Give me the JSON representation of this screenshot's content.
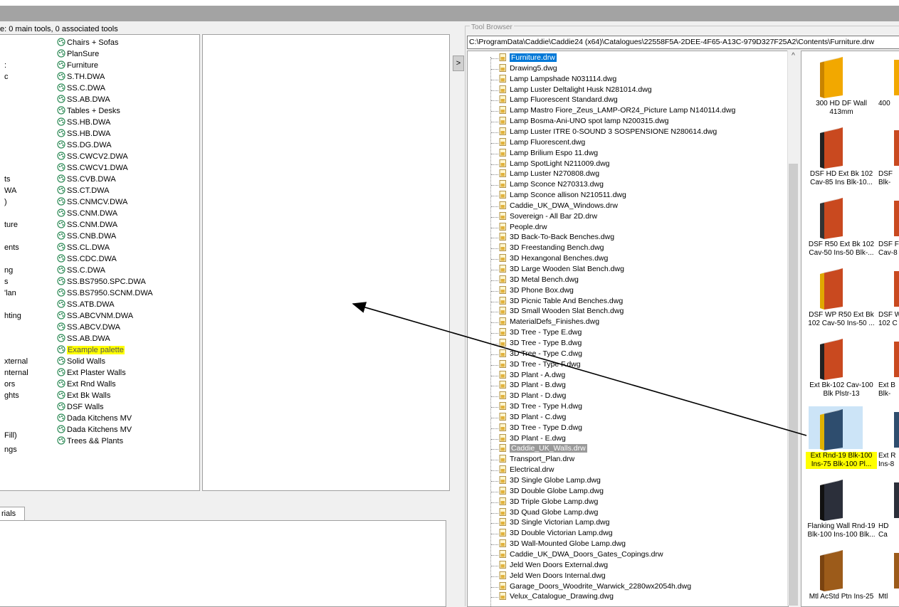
{
  "left": {
    "caption": "e: 0 main tools, 0 associated tools",
    "palettes": [
      "Chairs + Sofas",
      "PlanSure",
      "Furniture",
      "S.TH.DWA",
      "SS.C.DWA",
      "SS.AB.DWA",
      "Tables + Desks",
      "SS.HB.DWA",
      "SS.HB.DWA",
      "SS.DG.DWA",
      "SS.CWCV2.DWA",
      "SS.CWCV1.DWA",
      "SS.CVB.DWA",
      "SS.CT.DWA",
      "SS.CNMCV.DWA",
      "SS.CNM.DWA",
      "SS.CNM.DWA",
      "SS.CNB.DWA",
      "SS.CL.DWA",
      "SS.CDC.DWA",
      "SS.C.DWA",
      "SS.BS7950.SPC.DWA",
      "SS.BS7950.SCNM.DWA",
      "SS.ATB.DWA",
      "SS.ABCVNM.DWA",
      "SS.ABCV.DWA",
      "SS.AB.DWA",
      "Example palette",
      "Solid Walls",
      "Ext Plaster Walls",
      "Ext Rnd Walls",
      "Ext Bk Walls",
      "DSF Walls",
      "Dada Kitchens MV",
      "Dada Kitchens MV",
      "Trees && Plants"
    ],
    "fragments": [
      ":",
      "c",
      ":",
      "ts",
      "WA",
      ")",
      "ture",
      "ents",
      "ng",
      "s",
      "'lan",
      "hting",
      "xternal",
      "nternal",
      "ors",
      "ghts",
      "Fill)",
      "ngs"
    ],
    "tab_label": "rials"
  },
  "browser": {
    "collapse_label": ">",
    "title": "Tool Browser",
    "path": "C:\\ProgramData\\Caddie\\Caddie24 (x64)\\Catalogues\\22558F5A-2DEE-4F65-A13C-979D327F25A2\\Contents\\Furniture.drw",
    "scroll_up": "^",
    "files": [
      "Furniture.drw",
      "Drawing5.dwg",
      "Lamp Lampshade N031114.dwg",
      "Lamp Luster Deltalight Husk N281014.dwg",
      "Lamp Fluorescent Standard.dwg",
      "Lamp Mastro Fiore_Zeus_LAMP-OR24_Picture Lamp N140114.dwg",
      "Lamp Bosma-Ani-UNO spot lamp N200315.dwg",
      "Lamp Luster ITRE 0-SOUND 3 SOSPENSIONE N280614.dwg",
      "Lamp Fluorescent.dwg",
      "Lamp Brilium Espo 11.dwg",
      "Lamp SpotLight N211009.dwg",
      "Lamp Luster N270808.dwg",
      "Lamp Sconce N270313.dwg",
      "Lamp Sconce allison N210511.dwg",
      "Caddie_UK_DWA_Windows.drw",
      "Sovereign - All Bar 2D.drw",
      "People.drw",
      "3D Back-To-Back Benches.dwg",
      "3D Freestanding Bench.dwg",
      "3D Hexangonal Benches.dwg",
      "3D Large Wooden Slat Bench.dwg",
      "3D Metal Bench.dwg",
      "3D Phone Box.dwg",
      "3D Picnic Table And Benches.dwg",
      "3D Small Wooden Slat Bench.dwg",
      "MaterialDefs_Finishes.dwg",
      "3D Tree - Type E.dwg",
      "3D Tree - Type B.dwg",
      "3D Tree - Type C.dwg",
      "3D Tree - Type F.dwg",
      "3D Plant - A.dwg",
      "3D Plant - B.dwg",
      "3D Plant - D.dwg",
      "3D Tree - Type H.dwg",
      "3D Plant - C.dwg",
      "3D Tree - Type D.dwg",
      "3D Plant - E.dwg",
      "Caddie_UK_Walls.drw",
      "Transport_Plan.drw",
      "Electrical.drw",
      "3D Single Globe Lamp.dwg",
      "3D Double Globe Lamp.dwg",
      "3D Triple Globe Lamp.dwg",
      "3D Quad Globe Lamp.dwg",
      "3D Single Victorian Lamp.dwg",
      "3D Double Victorian Lamp.dwg",
      "3D Wall-Mounted Globe Lamp.dwg",
      "Caddie_UK_DWA_Doors_Gates_Copings.drw",
      "Jeld Wen Doors External.dwg",
      "Jeld Wen Doors Internal.dwg",
      "Garage_Doors_Woodrite_Warwick_2280wx2054h.dwg",
      "Velux_Catalogue_Drawing.dwg"
    ],
    "tiles": [
      {
        "label1": "300 HD DF Wall",
        "label2": "413mm",
        "right1": "400",
        "right2": ""
      },
      {
        "label1": "DSF HD Ext Bk 102",
        "label2": "Cav-85 Ins Blk-10...",
        "right1": "DSF",
        "right2": "Blk-"
      },
      {
        "label1": "DSF R50 Ext Bk 102",
        "label2": "Cav-50 Ins-50 Blk-...",
        "right1": "DSF F",
        "right2": "Cav-8"
      },
      {
        "label1": "DSF WP R50 Ext Bk",
        "label2": "102 Cav-50 Ins-50 ...",
        "right1": "DSF W",
        "right2": "102 C"
      },
      {
        "label1": "Ext Bk-102 Cav-100",
        "label2": "Blk Plstr-13",
        "right1": "Ext B",
        "right2": "Blk-"
      },
      {
        "label1": "Ext Rnd-19 Blk-100",
        "label2": "Ins-75 Blk-100 Pl...",
        "right1": "Ext R",
        "right2": "Ins-8"
      },
      {
        "label1": "Flanking Wall Rnd-19",
        "label2": "Blk-100 Ins-100 Blk...",
        "right1": "HD",
        "right2": "Ca"
      },
      {
        "label1": "Mtl AcStd Ptn Ins-25",
        "label2": "",
        "right1": "Mtl",
        "right2": ""
      }
    ],
    "colors": {
      "selection": "#0078d7",
      "highlight": "#ffff00",
      "arrow": "#000000"
    }
  }
}
